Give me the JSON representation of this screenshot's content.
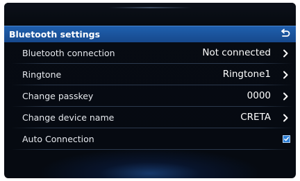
{
  "header": {
    "title": "Bluetooth settings",
    "back_icon": "back-arrow-icon"
  },
  "rows": [
    {
      "label": "Bluetooth connection",
      "value": "Not connected",
      "icon": "chevron-right-icon"
    },
    {
      "label": "Ringtone",
      "value": "Ringtone1",
      "icon": "chevron-right-icon"
    },
    {
      "label": "Change passkey",
      "value": "0000",
      "icon": "chevron-right-icon"
    },
    {
      "label": "Change device name",
      "value": "CRETA",
      "icon": "chevron-right-icon"
    },
    {
      "label": "Auto Connection",
      "checked": true,
      "icon": "checkbox-checked-icon"
    }
  ],
  "colors": {
    "header_blue": "#1f5fae",
    "background": "#060a11",
    "checkbox_blue": "#2d7fd6"
  }
}
